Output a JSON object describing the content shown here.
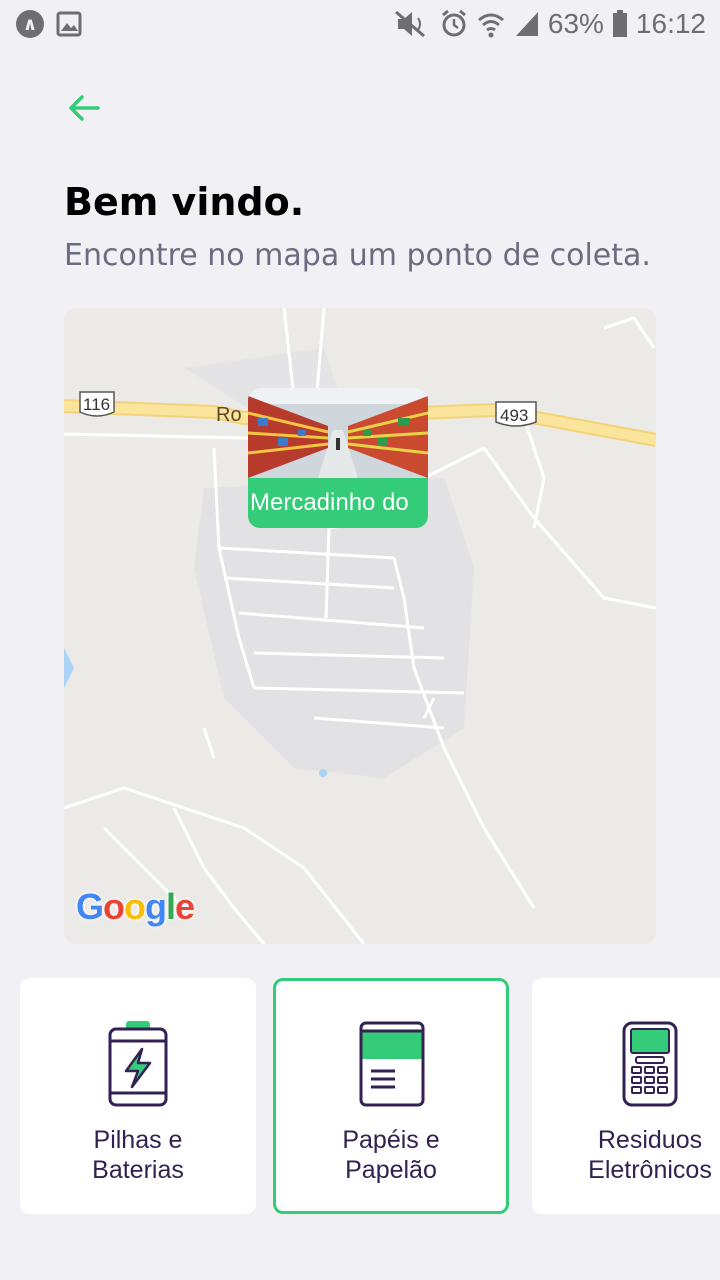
{
  "status_bar": {
    "battery": "63%",
    "time": "16:12",
    "icons": [
      "app-a-icon",
      "image-icon",
      "mute-icon",
      "alarm-icon",
      "wifi-icon",
      "signal-icon",
      "battery-icon"
    ]
  },
  "header": {
    "title": "Bem vindo.",
    "subtitle": "Encontre no mapa um ponto de coleta."
  },
  "map": {
    "road_labels": [
      "116",
      "493"
    ],
    "road_name_fragment": "Ro",
    "attribution": "Google",
    "marker": {
      "label": "Mercadinho do"
    }
  },
  "items": [
    {
      "label": "Pilhas e\nBaterias",
      "icon": "battery-icon",
      "selected": false
    },
    {
      "label": "Papéis e\nPapelão",
      "icon": "paper-icon",
      "selected": true
    },
    {
      "label": "Residuos\nEletrônicos",
      "icon": "electronics-icon",
      "selected": false
    }
  ],
  "colors": {
    "accent": "#34cb79",
    "title": "#000000",
    "subtitle": "#6c6c80",
    "item_text": "#322153",
    "background": "#f0f0f5"
  }
}
